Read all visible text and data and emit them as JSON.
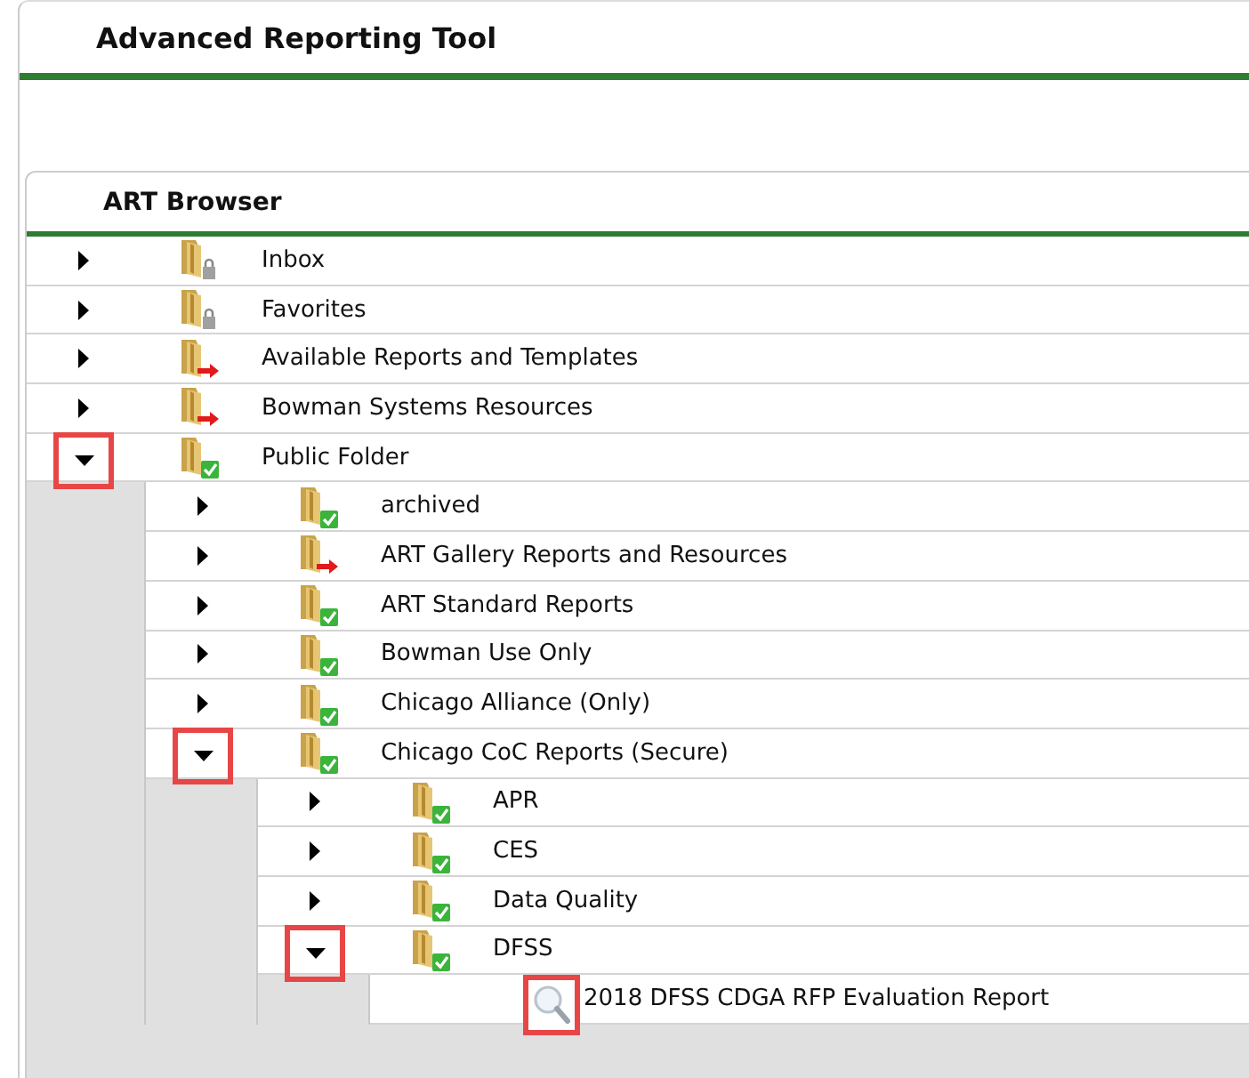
{
  "window": {
    "title": "Advanced Reporting Tool"
  },
  "browser": {
    "title": "ART Browser",
    "tree": [
      {
        "kind": "locked",
        "label": "Inbox",
        "expanded": false,
        "marked": false
      },
      {
        "kind": "locked",
        "label": "Favorites",
        "expanded": false,
        "marked": false
      },
      {
        "kind": "linked",
        "label": "Available Reports and Templates",
        "expanded": false,
        "marked": false
      },
      {
        "kind": "linked",
        "label": "Bowman Systems Resources",
        "expanded": false,
        "marked": false
      },
      {
        "kind": "shared",
        "label": "Public Folder",
        "expanded": true,
        "marked": true,
        "children": [
          {
            "kind": "shared",
            "label": "archived",
            "expanded": false,
            "marked": false
          },
          {
            "kind": "linked",
            "label": "ART Gallery Reports and Resources",
            "expanded": false,
            "marked": false
          },
          {
            "kind": "shared",
            "label": "ART Standard Reports",
            "expanded": false,
            "marked": false
          },
          {
            "kind": "shared",
            "label": "Bowman Use Only",
            "expanded": false,
            "marked": false
          },
          {
            "kind": "shared",
            "label": "Chicago Alliance (Only)",
            "expanded": false,
            "marked": false
          },
          {
            "kind": "shared",
            "label": "Chicago CoC Reports (Secure)",
            "expanded": true,
            "marked": true,
            "children": [
              {
                "kind": "shared",
                "label": "APR",
                "expanded": false,
                "marked": false
              },
              {
                "kind": "shared",
                "label": "CES",
                "expanded": false,
                "marked": false
              },
              {
                "kind": "shared",
                "label": "Data Quality",
                "expanded": false,
                "marked": false
              },
              {
                "kind": "shared",
                "label": "DFSS",
                "expanded": true,
                "marked": true,
                "children": [
                  {
                    "kind": "report",
                    "label": "2018 DFSS CDGA RFP Evaluation Report",
                    "marked": true
                  }
                ]
              }
            ]
          }
        ]
      }
    ]
  }
}
